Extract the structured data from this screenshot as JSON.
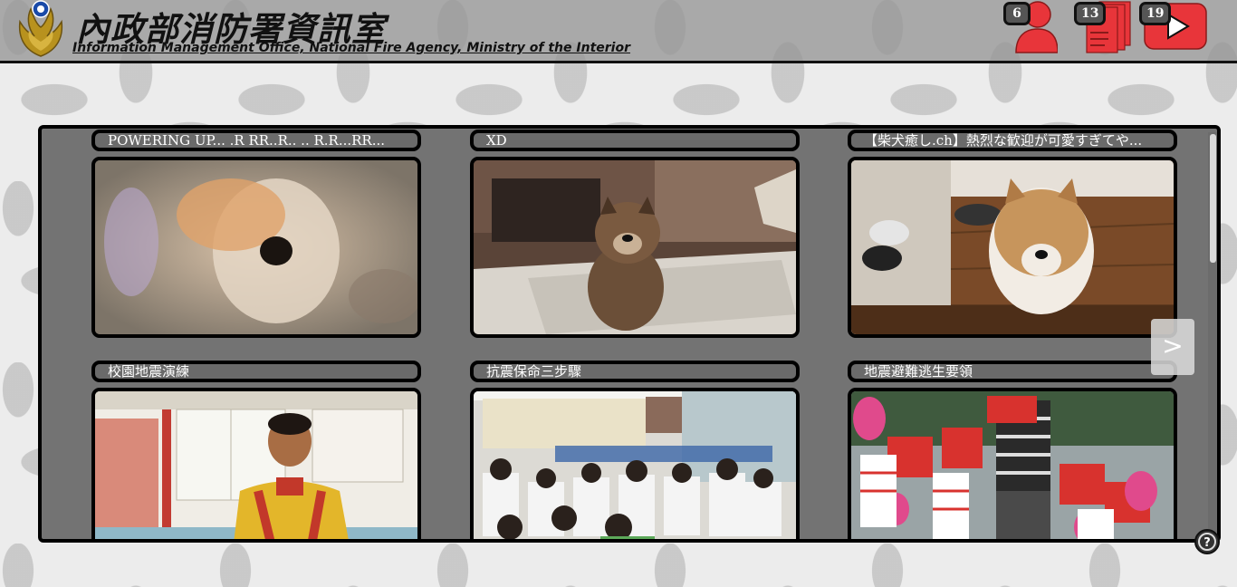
{
  "header": {
    "title_zh": "內政部消防署資訊室",
    "title_en": "Information Management Office, National Fire Agency, Ministry of the Interior",
    "emblem_icon": "fire-agency-emblem-icon",
    "buttons": [
      {
        "icon": "user-icon",
        "count": "6",
        "color": "#e8353a"
      },
      {
        "icon": "documents-icon",
        "count": "13",
        "color": "#e8353a"
      },
      {
        "icon": "video-play-icon",
        "count": "19",
        "color": "#e8353a"
      }
    ]
  },
  "videos": [
    {
      "title": "POWERING UP... .R RR..R.. .. R.R...RR...",
      "thumb": "blurred-shiba-dog"
    },
    {
      "title": "XD",
      "thumb": "shiba-puppy-sitting"
    },
    {
      "title": "【柴犬癒し.ch】熱烈な歓迎が可愛すぎてや...",
      "thumb": "shiba-dog-entrance"
    },
    {
      "title": "校園地震演練",
      "thumb": "firefighter-classroom"
    },
    {
      "title": "抗震保命三步驟",
      "thumb": "classroom-students"
    },
    {
      "title": "地震避難逃生要領",
      "thumb": "children-cushions"
    }
  ],
  "controls": {
    "next_label": ">",
    "help_icon": "help-icon"
  }
}
